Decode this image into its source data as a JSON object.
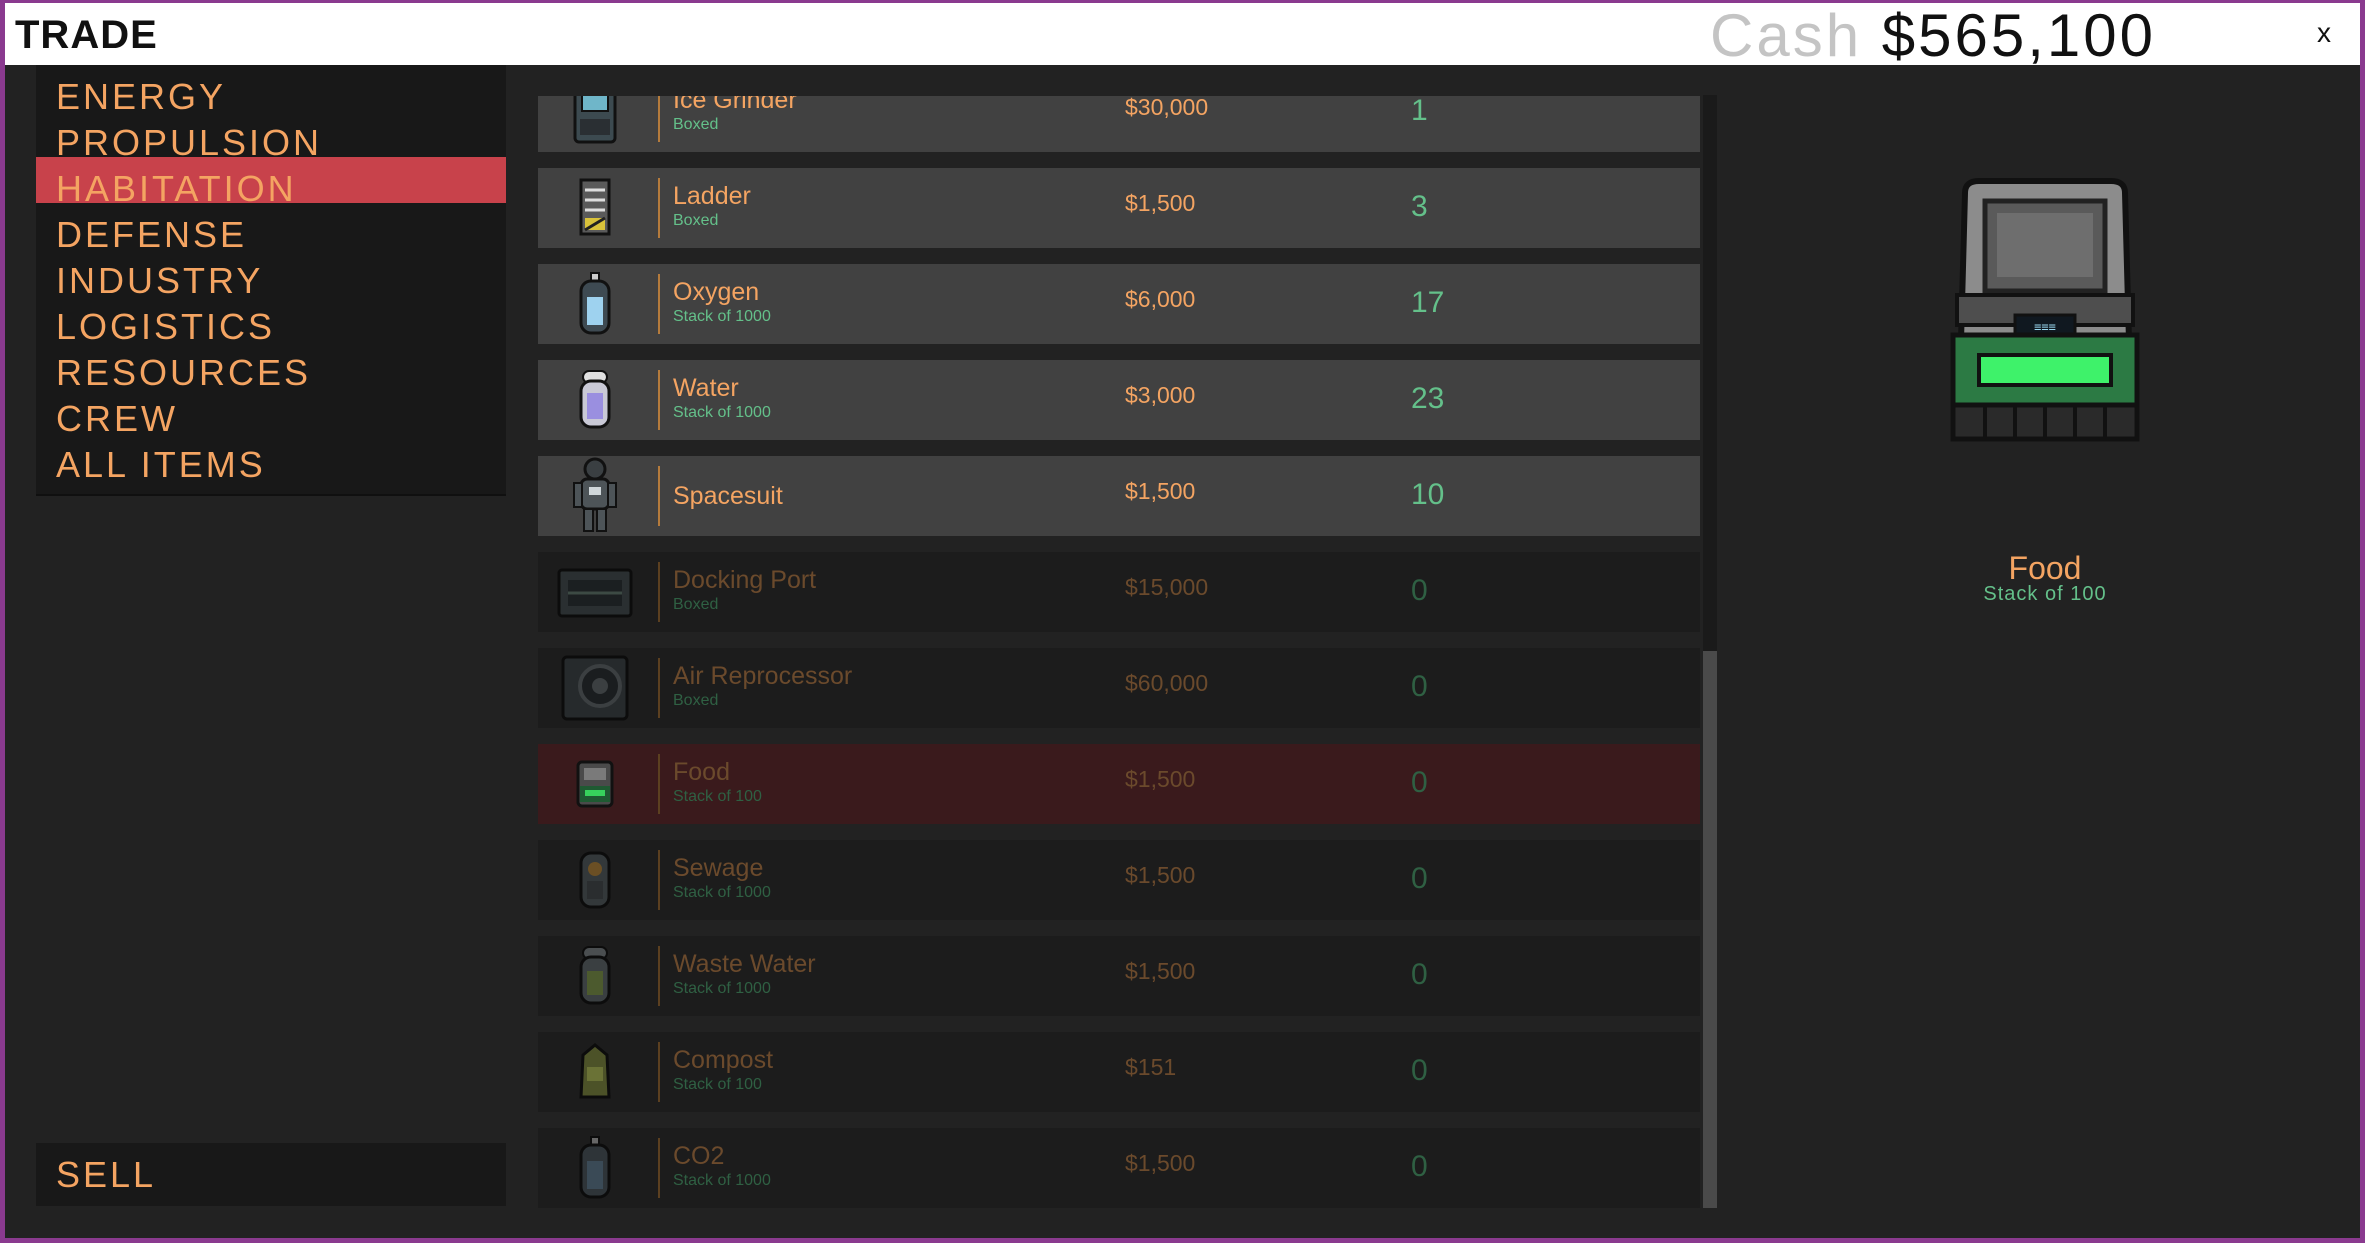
{
  "window": {
    "title": "TRADE",
    "cash_label": "Cash",
    "cash_value": "$565,100",
    "close_label": "x"
  },
  "categories": [
    {
      "label": "ENERGY",
      "active": false
    },
    {
      "label": "PROPULSION",
      "active": false
    },
    {
      "label": "HABITATION",
      "active": true
    },
    {
      "label": "DEFENSE",
      "active": false
    },
    {
      "label": "INDUSTRY",
      "active": false
    },
    {
      "label": "LOGISTICS",
      "active": false
    },
    {
      "label": "RESOURCES",
      "active": false
    },
    {
      "label": "CREW",
      "active": false
    },
    {
      "label": "ALL ITEMS",
      "active": false
    }
  ],
  "sell_label": "SELL",
  "items": [
    {
      "name": "Ice Grinder",
      "sub": "Boxed",
      "price": "$30,000",
      "qty": "1",
      "icon": "ice-grinder-icon",
      "state": "owned"
    },
    {
      "name": "Ladder",
      "sub": "Boxed",
      "price": "$1,500",
      "qty": "3",
      "icon": "ladder-icon",
      "state": "owned"
    },
    {
      "name": "Oxygen",
      "sub": "Stack of 1000",
      "price": "$6,000",
      "qty": "17",
      "icon": "oxygen-canister-icon",
      "state": "owned"
    },
    {
      "name": "Water",
      "sub": "Stack of 1000",
      "price": "$3,000",
      "qty": "23",
      "icon": "water-canister-icon",
      "state": "owned"
    },
    {
      "name": "Spacesuit",
      "sub": "",
      "price": "$1,500",
      "qty": "10",
      "icon": "spacesuit-icon",
      "state": "owned"
    },
    {
      "name": "Docking Port",
      "sub": "Boxed",
      "price": "$15,000",
      "qty": "0",
      "icon": "docking-port-icon",
      "state": "none"
    },
    {
      "name": "Air Reprocessor",
      "sub": "Boxed",
      "price": "$60,000",
      "qty": "0",
      "icon": "air-reprocessor-icon",
      "state": "none"
    },
    {
      "name": "Food",
      "sub": "Stack of 100",
      "price": "$1,500",
      "qty": "0",
      "icon": "food-crate-icon",
      "state": "selected"
    },
    {
      "name": "Sewage",
      "sub": "Stack of 1000",
      "price": "$1,500",
      "qty": "0",
      "icon": "sewage-canister-icon",
      "state": "none"
    },
    {
      "name": "Waste Water",
      "sub": "Stack of 1000",
      "price": "$1,500",
      "qty": "0",
      "icon": "waste-water-canister-icon",
      "state": "none"
    },
    {
      "name": "Compost",
      "sub": "Stack of 100",
      "price": "$151",
      "qty": "0",
      "icon": "compost-icon",
      "state": "none"
    },
    {
      "name": "CO2",
      "sub": "Stack of 1000",
      "price": "$1,500",
      "qty": "0",
      "icon": "co2-canister-icon",
      "state": "none"
    }
  ],
  "preview": {
    "name": "Food",
    "sub": "Stack of 100",
    "icon": "food-crate-icon"
  },
  "colors": {
    "accent": "#f4a462",
    "active_category": "#c8424b",
    "quantity": "#64c08a",
    "selected_row": "#3a1a1c"
  }
}
